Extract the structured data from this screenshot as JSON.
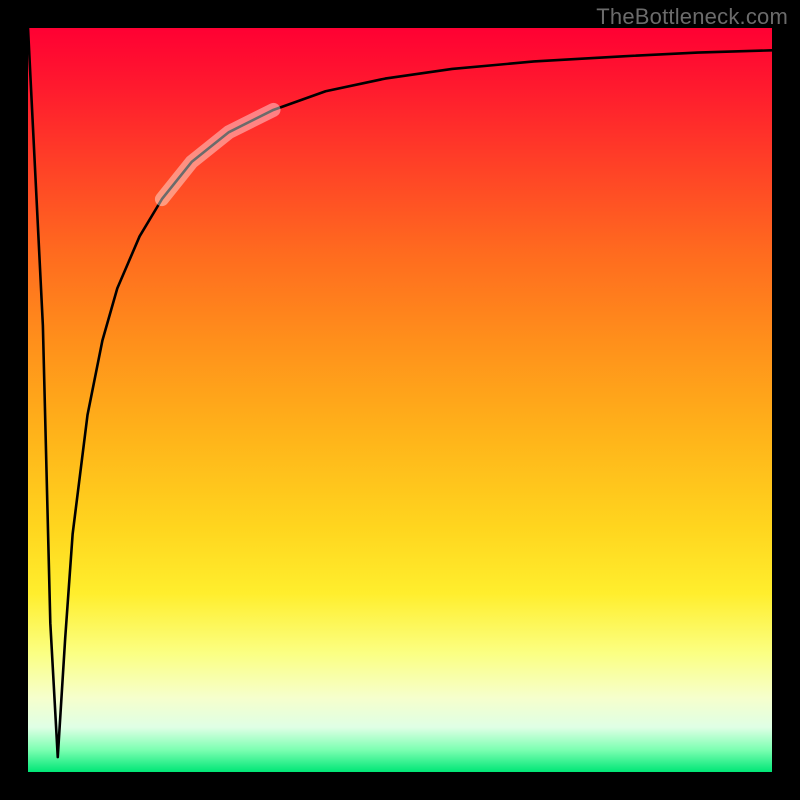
{
  "watermark": "TheBottleneck.com",
  "chart_data": {
    "type": "line",
    "title": "",
    "xlabel": "",
    "ylabel": "",
    "xlim": [
      0,
      100
    ],
    "ylim": [
      0,
      100
    ],
    "grid": false,
    "legend": false,
    "series": [
      {
        "name": "bottleneck-curve",
        "x": [
          0,
          2,
          3,
          4,
          5,
          6,
          8,
          10,
          12,
          15,
          18,
          22,
          27,
          33,
          40,
          48,
          57,
          68,
          80,
          90,
          100
        ],
        "y": [
          100,
          60,
          20,
          2,
          18,
          32,
          48,
          58,
          65,
          72,
          77,
          82,
          86,
          89,
          91.5,
          93.2,
          94.5,
          95.5,
          96.2,
          96.7,
          97
        ]
      },
      {
        "name": "highlight-segment",
        "x": [
          18,
          22,
          27,
          33
        ],
        "y": [
          77,
          82,
          86,
          89
        ]
      }
    ],
    "colors": {
      "curve": "#000000",
      "highlight": "rgba(255,255,255,0.42)",
      "gradient_top": "#ff0033",
      "gradient_bottom": "#00e676"
    }
  }
}
